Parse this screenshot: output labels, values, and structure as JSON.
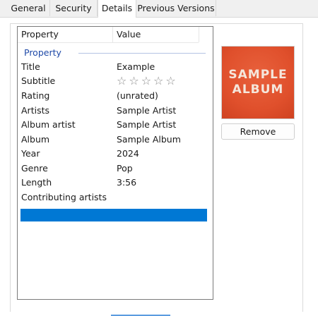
{
  "tabs": [
    {
      "label": "General"
    },
    {
      "label": "Security"
    },
    {
      "label": "Details",
      "active": true
    },
    {
      "label": "Previous Versions"
    }
  ],
  "table": {
    "col_property": "Property",
    "col_value": "Value",
    "group_label": "Property",
    "rows": [
      {
        "property": "Title",
        "value": "Example"
      },
      {
        "property": "Subtitle",
        "value": ""
      },
      {
        "property": "Rating",
        "value": "(unrated)"
      },
      {
        "property": "Artists",
        "value": "Sample Artist"
      },
      {
        "property": "Album artist",
        "value": "Sample Artist"
      },
      {
        "property": "Album",
        "value": "Sample Album"
      },
      {
        "property": "Year",
        "value": "2024"
      },
      {
        "property": "Genre",
        "value": "Pop"
      },
      {
        "property": "Length",
        "value": "3:56"
      },
      {
        "property": "Contributing artists",
        "value": ""
      }
    ],
    "rating_stars": "☆☆☆☆☆"
  },
  "album_art": {
    "line1": "SAMPLE",
    "line2": "ALBUM",
    "accent_color": "#e0502c"
  },
  "buttons": {
    "remove_label": "Remove"
  }
}
